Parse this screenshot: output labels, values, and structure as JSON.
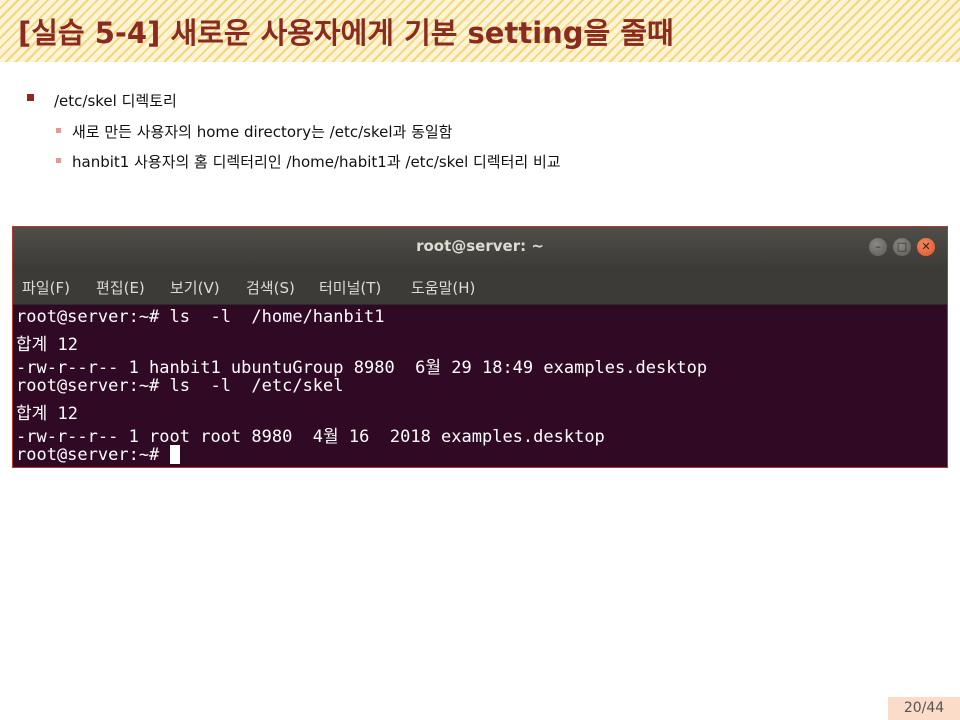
{
  "slide": {
    "title": "[실습 5-4] 새로운 사용자에게 기본 setting을 줄때",
    "bullet_main": "/etc/skel 디렉토리",
    "bullet_sub1": "새로 만든 사용자의 home directory는 /etc/skel과 동일함",
    "bullet_sub2": "hanbit1 사용자의 홈 디렉터리인 /home/habit1과 /etc/skel 디렉터리 비교",
    "page_number": "20/44",
    "accent_color": "#8b2a1e"
  },
  "terminal": {
    "title": "root@server: ~",
    "menu": [
      "파일(F)",
      "편집(E)",
      "보기(V)",
      "검색(S)",
      "터미널(T)",
      "도움말(H)"
    ],
    "lines": [
      "root@server:~# ls  -l  /home/hanbit1",
      "합계 12",
      "-rw-r--r-- 1 hanbit1 ubuntuGroup 8980  6월 29 18:49 examples.desktop",
      "root@server:~# ls  -l  /etc/skel",
      "합계 12",
      "-rw-r--r-- 1 root root 8980  4월 16  2018 examples.desktop",
      "root@server:~# "
    ],
    "window_buttons": [
      "minimize-icon",
      "maximize-icon",
      "close-icon"
    ],
    "background_color": "#300a24"
  }
}
